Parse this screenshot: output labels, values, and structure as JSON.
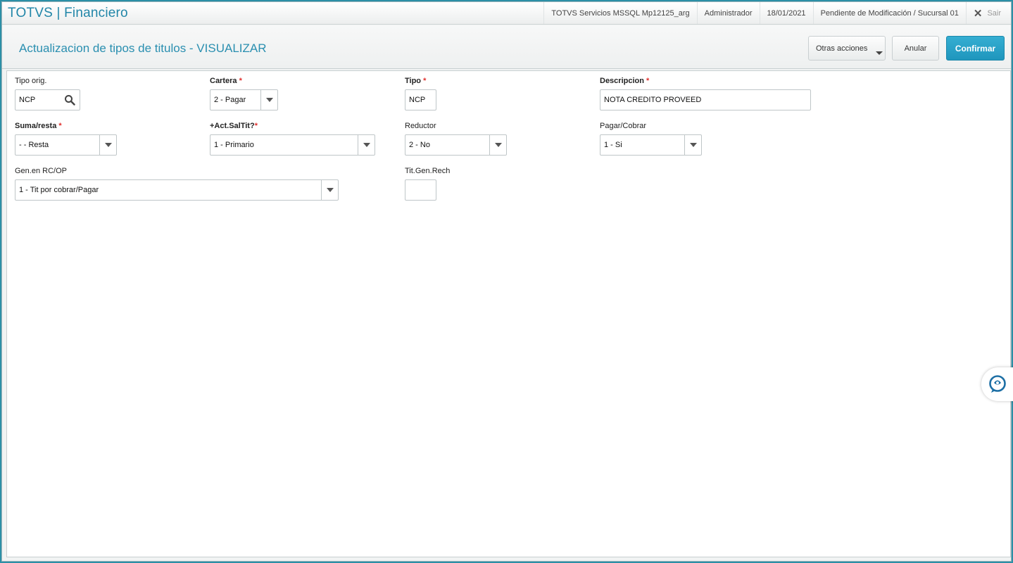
{
  "app": {
    "title": "TOTVS | Financiero",
    "top_items": {
      "server": "TOTVS Servicios MSSQL Mp12125_arg",
      "user": "Administrador",
      "date": "18/01/2021",
      "branch": "Pendiente de Modificación / Sucursal 01",
      "exit": "Sair"
    }
  },
  "header": {
    "title": "Actualizacion de tipos de titulos - VISUALIZAR",
    "buttons": {
      "otras": "Otras acciones",
      "anular": "Anular",
      "confirmar": "Confirmar"
    }
  },
  "form": {
    "tipo_orig": {
      "label": "Tipo orig.",
      "value": "NCP"
    },
    "cartera": {
      "label": "Cartera",
      "required": "*",
      "value": "2 - Pagar"
    },
    "tipo": {
      "label": "Tipo",
      "required": "*",
      "value": "NCP"
    },
    "descripcion": {
      "label": "Descripcion",
      "required": "*",
      "value": "NOTA CREDITO PROVEED"
    },
    "suma_resta": {
      "label": "Suma/resta",
      "required": "*",
      "value": "- - Resta"
    },
    "act_saltit": {
      "label": "+Act.SalTit?",
      "required": "*",
      "value": "1 - Primario"
    },
    "reductor": {
      "label": "Reductor",
      "value": "2 - No"
    },
    "pagar_cobrar": {
      "label": "Pagar/Cobrar",
      "value": "1 - Si"
    },
    "gen_rcop": {
      "label": "Gen.en RC/OP",
      "value": "1 - Tit por cobrar/Pagar"
    },
    "tit_gen_rech": {
      "label": "Tit.Gen.Rech",
      "value": ""
    }
  },
  "colors": {
    "accent": "#2186a8",
    "confirm_button": "#2aa3c9",
    "required_marker": "#e0302e"
  },
  "icons": [
    "search-icon",
    "close-icon",
    "chevron-down-icon",
    "help-chat-icon"
  ]
}
